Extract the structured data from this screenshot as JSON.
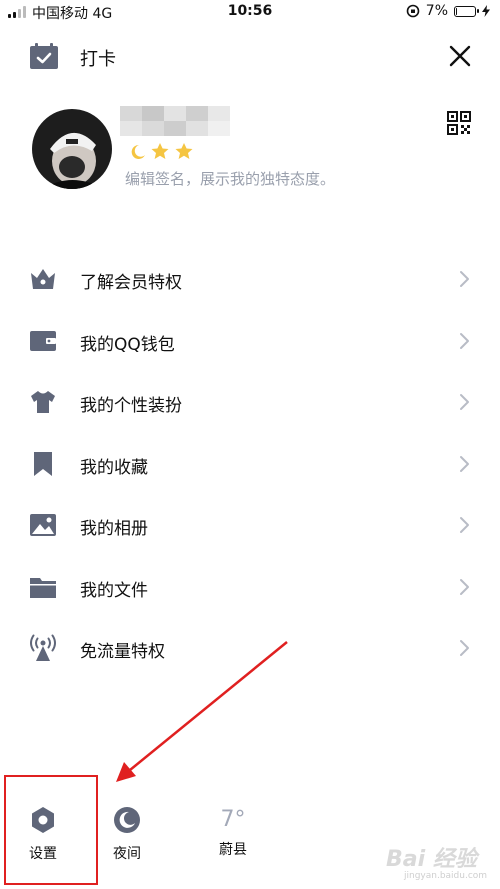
{
  "status_bar": {
    "carrier": "中国移动 4G",
    "time": "10:56",
    "battery": "7%",
    "battery_level": 0.07
  },
  "header": {
    "checkin_label": "打卡",
    "checkin_icon": "calendar-check-icon",
    "close_icon": "close-icon"
  },
  "profile": {
    "signature": "编辑签名，展示我的独特态度。",
    "qr_icon": "qr-code-icon"
  },
  "menu": {
    "items": [
      {
        "label": "了解会员特权",
        "icon": "crown-icon"
      },
      {
        "label": "我的QQ钱包",
        "icon": "wallet-icon"
      },
      {
        "label": "我的个性装扮",
        "icon": "shirt-icon"
      },
      {
        "label": "我的收藏",
        "icon": "bookmark-icon"
      },
      {
        "label": "我的相册",
        "icon": "photo-icon"
      },
      {
        "label": "我的文件",
        "icon": "folder-icon"
      },
      {
        "label": "免流量特权",
        "icon": "antenna-icon"
      }
    ]
  },
  "bottom": {
    "settings_label": "设置",
    "night_label": "夜间",
    "weather_temp": "7°",
    "weather_city": "蔚县"
  },
  "watermark": {
    "text": "Bai 经验",
    "url": "jingyan.baidu.com"
  },
  "colors": {
    "icon": "#5f6679",
    "muted": "#9aa0ad",
    "chevron": "#b8bcc6",
    "annotation": "#e02020"
  }
}
